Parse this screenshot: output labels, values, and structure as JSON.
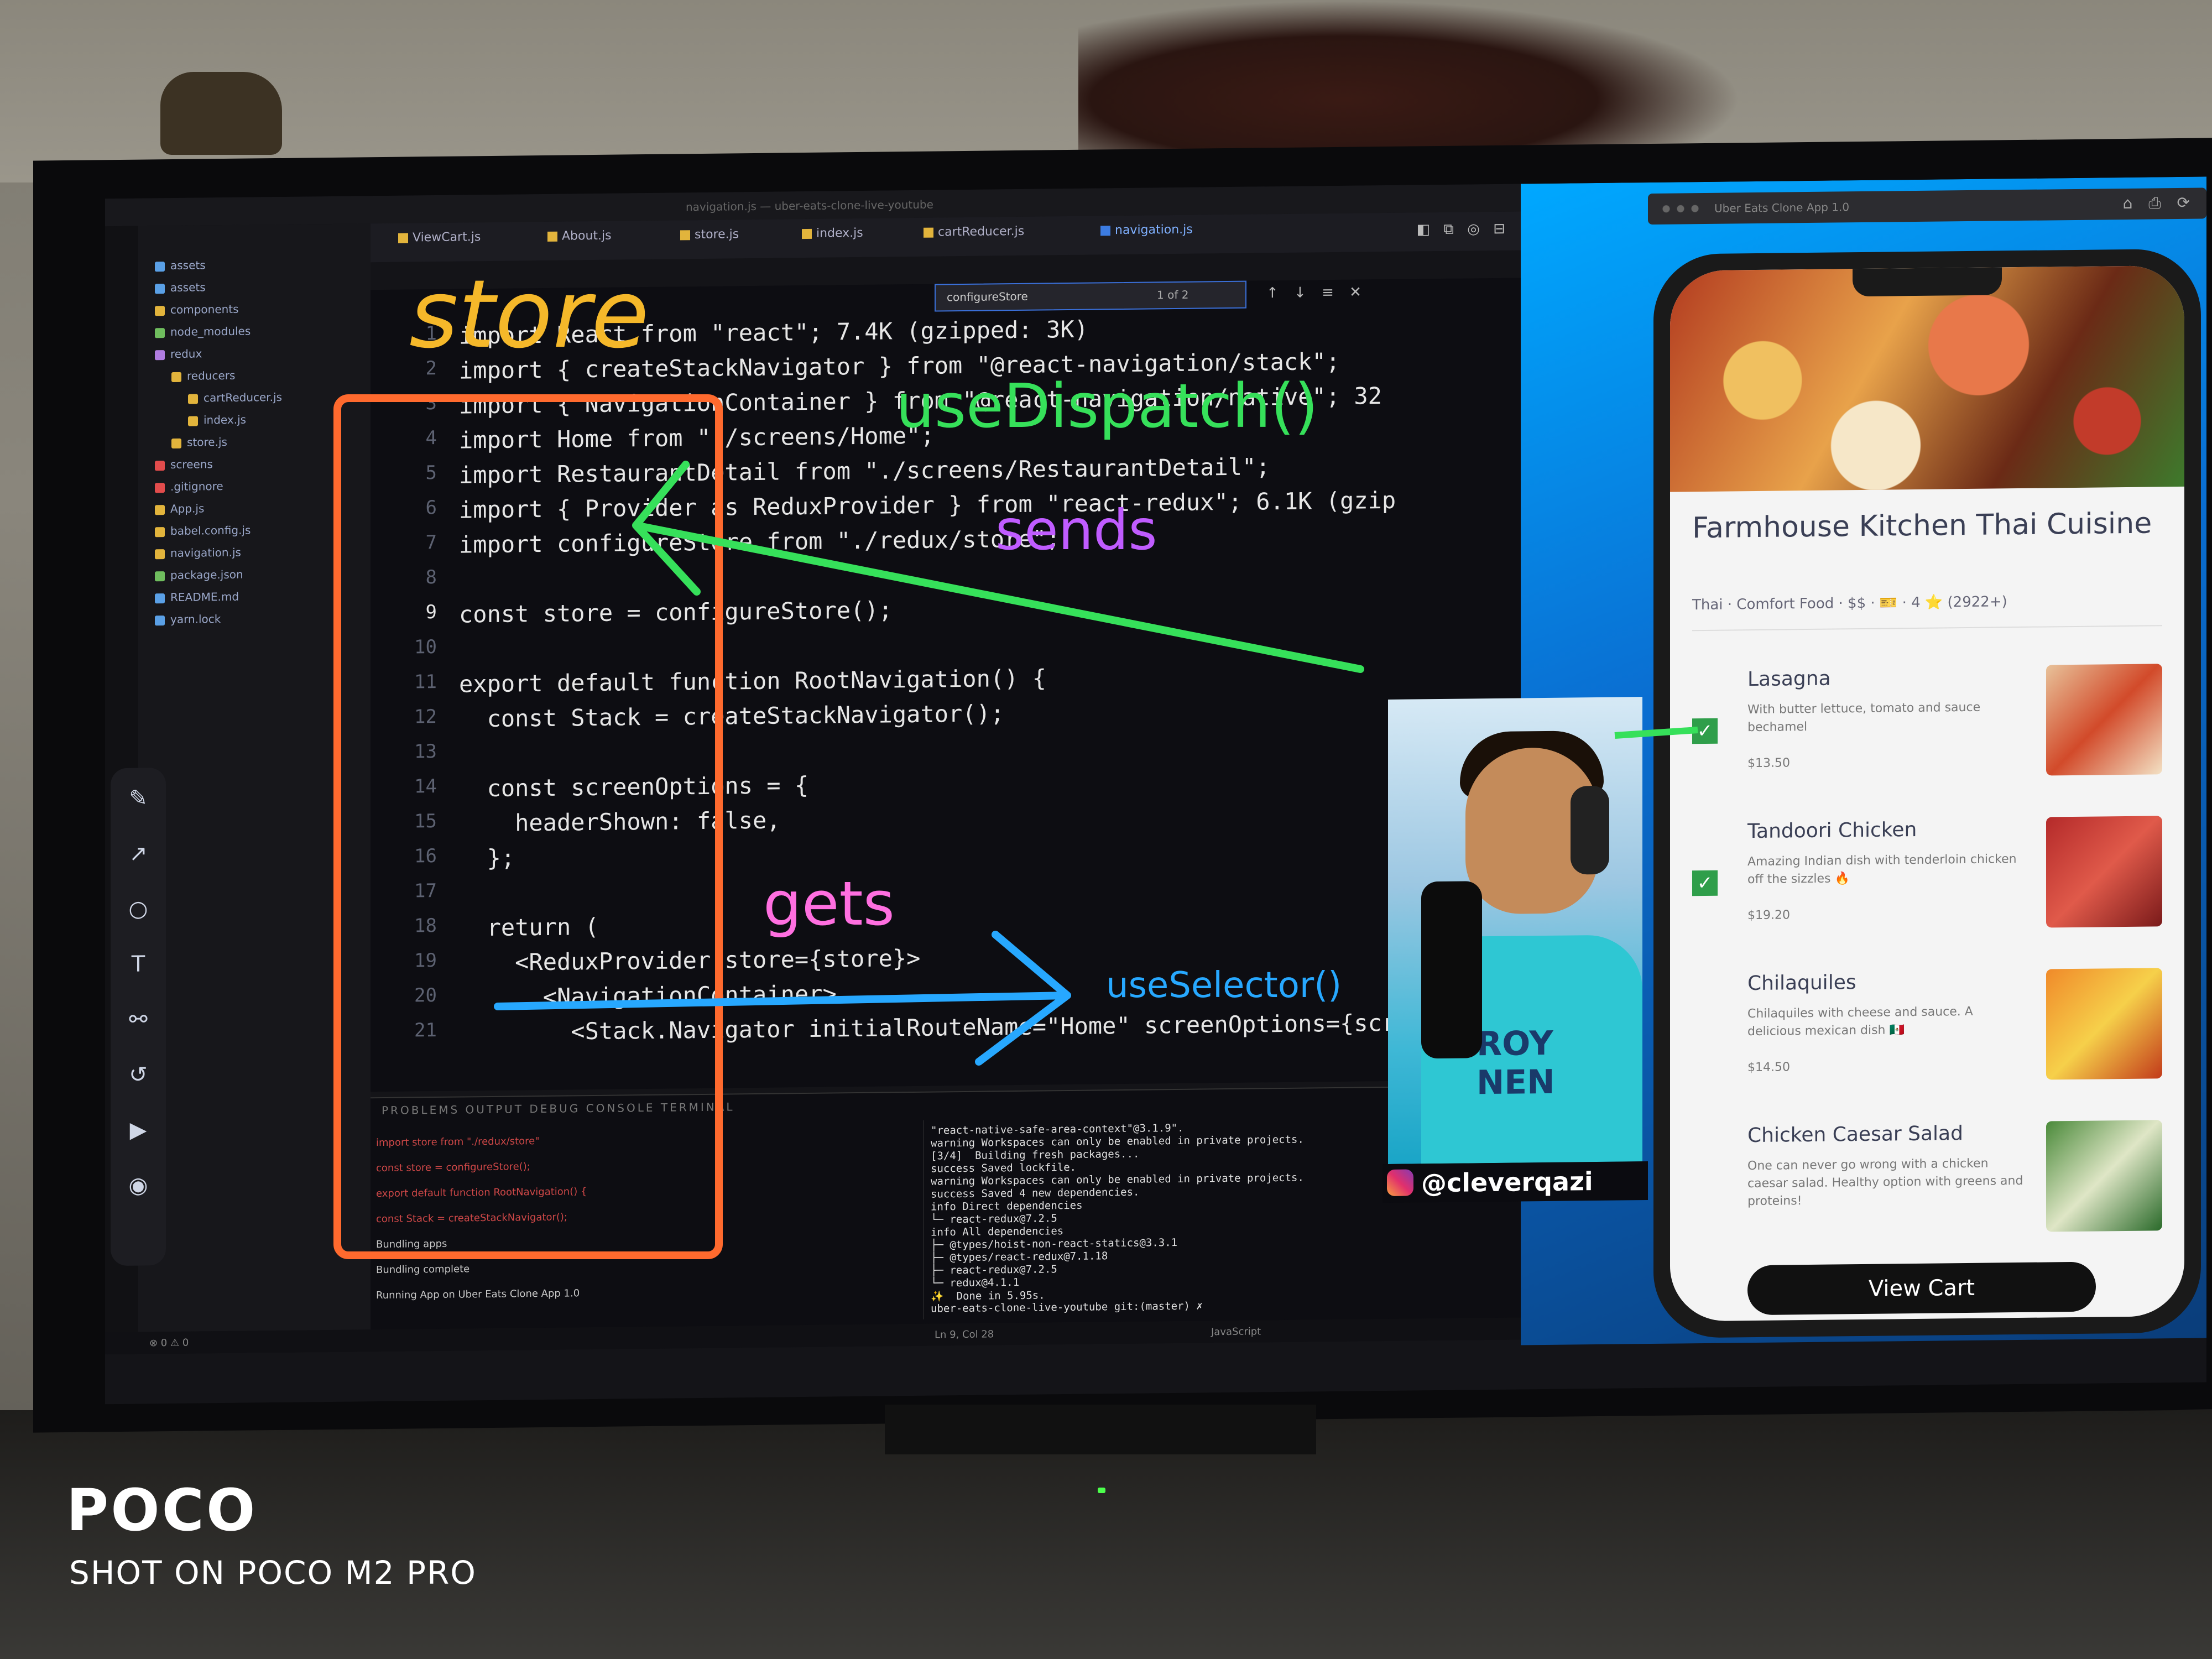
{
  "editor": {
    "tabs": [
      "ViewCart.js",
      "About.js",
      "store.js",
      "index.js",
      "cartReducer.js",
      "navigation.js"
    ],
    "active_tab": "navigation.js",
    "search_value": "configureStore",
    "search_count": "1 of 2",
    "code_lines": [
      {
        "n": "1",
        "text": "import React from \"react\"; 7.4K (gzipped: 3K)"
      },
      {
        "n": "2",
        "text": "import { createStackNavigator } from \"@react-navigation/stack\";"
      },
      {
        "n": "3",
        "text": "import { NavigationContainer } from \"@react-navigation/native\"; 32"
      },
      {
        "n": "4",
        "text": "import Home from \"./screens/Home\";"
      },
      {
        "n": "5",
        "text": "import RestaurantDetail from \"./screens/RestaurantDetail\";"
      },
      {
        "n": "6",
        "text": "import { Provider as ReduxProvider } from \"react-redux\"; 6.1K (gzip"
      },
      {
        "n": "7",
        "text": "import configureStore from \"./redux/store\";"
      },
      {
        "n": "8",
        "text": ""
      },
      {
        "n": "9",
        "text": "const store = configureStore();"
      },
      {
        "n": "10",
        "text": ""
      },
      {
        "n": "11",
        "text": "export default function RootNavigation() {"
      },
      {
        "n": "12",
        "text": "  const Stack = createStackNavigator();"
      },
      {
        "n": "13",
        "text": ""
      },
      {
        "n": "14",
        "text": "  const screenOptions = {"
      },
      {
        "n": "15",
        "text": "    headerShown: false,"
      },
      {
        "n": "16",
        "text": "  };"
      },
      {
        "n": "17",
        "text": ""
      },
      {
        "n": "18",
        "text": "  return ("
      },
      {
        "n": "19",
        "text": "    <ReduxProvider store={store}>"
      },
      {
        "n": "20",
        "text": "      <NavigationContainer>"
      },
      {
        "n": "21",
        "text": "        <Stack.Navigator initialRouteName=\"Home\" screenOptions={scr"
      }
    ],
    "terminal_lines": [
      "\"react-native-safe-area-context\"@3.1.9\".",
      "warning Workspaces can only be enabled in private projects.",
      "[3/4]  Building fresh packages...",
      "success Saved lockfile.",
      "warning Workspaces can only be enabled in private projects.",
      "success Saved 4 new dependencies.",
      "info Direct dependencies",
      "└─ react-redux@7.2.5",
      "info All dependencies",
      "├─ @types/hoist-non-react-statics@3.3.1",
      "├─ @types/react-redux@7.1.18",
      "├─ react-redux@7.2.5",
      "└─ redux@4.1.1",
      "✨  Done in 5.95s.",
      "uber-eats-clone-live-youtube git:(master) ✗"
    ],
    "left_panel_lines": [
      "import store from \"./redux/store\"",
      "const store = configureStore();",
      "export default function RootNavigation() {",
      "const Stack = createStackNavigator();",
      "Bundling apps",
      "Bundling complete",
      "Running App on Uber Eats Clone App 1.0"
    ]
  },
  "annotations": {
    "store": "store",
    "useDispatch": "useDispatch()",
    "sends": "sends",
    "gets": "gets",
    "useSelector": "useSelector()"
  },
  "app": {
    "restaurant_title": "Farmhouse Kitchen Thai Cuisine",
    "restaurant_meta": "Thai · Comfort Food · $$ · 🎫 · 4 ⭐ (2922+)",
    "menu": [
      {
        "name": "Lasagna",
        "desc": "With butter lettuce, tomato and sauce bechamel",
        "price": "$13.50",
        "checked": true
      },
      {
        "name": "Tandoori Chicken",
        "desc": "Amazing Indian dish with tenderloin chicken off the sizzles 🔥",
        "price": "$19.20",
        "checked": true
      },
      {
        "name": "Chilaquiles",
        "desc": "Chilaquiles with cheese and sauce. A delicious mexican dish 🇲🇽",
        "price": "$14.50",
        "checked": false
      },
      {
        "name": "Chicken Caesar Salad",
        "desc": "One can never go wrong with a chicken caesar salad. Healthy option with greens and proteins!",
        "price": "",
        "checked": false
      }
    ],
    "view_cart": "View Cart"
  },
  "streamer": {
    "handle": "@cleverqazi",
    "shirt_text": "ROY NEN"
  },
  "watermark": {
    "brand": "POCO",
    "shot": "SHOT ON POCO M2 PRO"
  },
  "colors": {
    "store_annotation": "#f5b82a",
    "dispatch_annotation": "#36e05a",
    "sends_annotation": "#c05cff",
    "gets_annotation": "#ff6fe0",
    "selector_annotation": "#27a8ff",
    "box_annotation": "#ff6a2e"
  }
}
